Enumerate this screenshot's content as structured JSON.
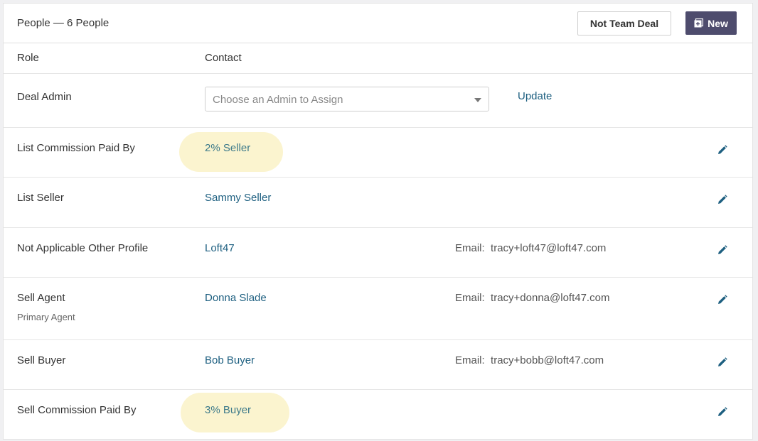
{
  "header": {
    "title": "People — 6 People",
    "team_button": "Not Team Deal",
    "new_button": "New"
  },
  "columns": {
    "role": "Role",
    "contact": "Contact"
  },
  "admin_row": {
    "role": "Deal Admin",
    "select_placeholder": "Choose an Admin to Assign",
    "update_label": "Update"
  },
  "rows": [
    {
      "role": "List Commission Paid By",
      "value": "2% Seller"
    },
    {
      "role": "List Seller",
      "contact": "Sammy Seller"
    },
    {
      "role": "Not Applicable Other Profile",
      "contact": "Loft47",
      "email_label": "Email:",
      "email": "tracy+loft47@loft47.com"
    },
    {
      "role": "Sell Agent",
      "sub": "Primary Agent",
      "contact": "Donna Slade",
      "email_label": "Email:",
      "email": "tracy+donna@loft47.com"
    },
    {
      "role": "Sell Buyer",
      "contact": "Bob Buyer",
      "email_label": "Email:",
      "email": "tracy+bobb@loft47.com"
    },
    {
      "role": "Sell Commission Paid By",
      "value": "3% Buyer"
    }
  ],
  "colors": {
    "accent": "#4e4c6d",
    "link": "#1d5f80",
    "highlight": "#fbf4cf"
  },
  "icons": {
    "edit": "pencil-icon",
    "new": "plus-square-icon",
    "dropdown": "chevron-down-icon"
  }
}
